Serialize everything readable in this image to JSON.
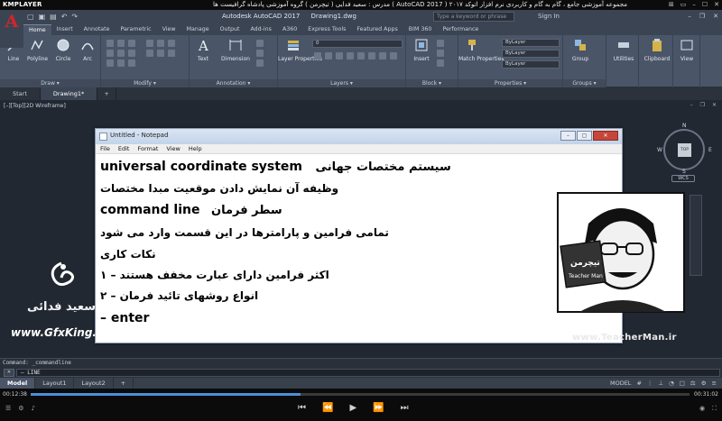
{
  "kmplayer": {
    "logo": "KMPLAYER",
    "title": "مجموعه آموزشی جامع ، گام به گام و کاربردی نرم افزار اتوکد ۲۰۱۷ ( AutoCAD 2017 ) مدرس : سعید فدایی ( تیچرمن ) گروه آموزشی پادشاه گرافیست ها",
    "ctrl_labels": [
      "⊞",
      "▭",
      "–",
      "☐",
      "✕"
    ]
  },
  "autocad": {
    "app_title": "Autodesk AutoCAD 2017",
    "doc_name": "Drawing1.dwg",
    "search_placeholder": "Type a keyword or phrase",
    "signin": "Sign In",
    "ribbon_tabs": [
      "Home",
      "Insert",
      "Annotate",
      "Parametric",
      "View",
      "Manage",
      "Output",
      "Add-ins",
      "A360",
      "Express Tools",
      "Featured Apps",
      "BIM 360",
      "Performance"
    ],
    "tools": {
      "line": "Line",
      "polyline": "Polyline",
      "circle": "Circle",
      "arc": "Arc",
      "text": "Text",
      "dimension": "Dimension",
      "layer_properties": "Layer Properties",
      "insert": "Insert",
      "match_properties": "Match Properties",
      "group": "Group",
      "utilities": "Utilities",
      "clipboard": "Clipboard",
      "view": "View"
    },
    "panels": {
      "draw": "Draw ▾",
      "modify": "Modify ▾",
      "annotation": "Annotation ▾",
      "layers": "Layers ▾",
      "block": "Block ▾",
      "properties": "Properties ▾",
      "groups": "Groups ▾"
    },
    "bylayer": [
      "ByLayer",
      "ByLayer",
      "ByLayer"
    ],
    "layer_dropdown": "0",
    "doc_tabs": [
      "Start",
      "Drawing1*"
    ],
    "viewport_label": "[–][Top][2D Wireframe]",
    "viewcube": {
      "top": "TOP",
      "n": "N",
      "s": "S",
      "w": "W",
      "e": "E",
      "wcs": "WCS"
    },
    "cmd_history": "Command: _commandline",
    "cmd_input": "– LINE",
    "layout_tabs": [
      "Model",
      "Layout1",
      "Layout2"
    ],
    "status_model": "MODEL"
  },
  "notepad": {
    "title": "Untitled - Notepad",
    "menu": [
      "File",
      "Edit",
      "Format",
      "View",
      "Help"
    ],
    "lines": [
      {
        "en": "universal coordinate system",
        "fa": "سیستم مختصات جهانی"
      },
      {
        "fa": "وظیفه آن نمایش دادن موقعیت مبدا مختصات"
      },
      {
        "en": "command line",
        "fa": "سطر فرمان"
      },
      {
        "fa": "تمامی فرامین و پارامترها در این قسمت وارد می شود"
      },
      {
        "fa": "نکات کاری"
      },
      {
        "fa": "اکثر فرامین دارای عبارت مخفف هستند  – ۱"
      },
      {
        "fa": "انواع روشهای تائید فرمان – ۲"
      },
      {
        "en": "– enter"
      }
    ]
  },
  "overlay": {
    "teacher_caption": "www.TeacherMan.ir",
    "badge_text": "تیچرمن",
    "badge_sub": "Teacher Man",
    "watermark_name": "سعید فدائی",
    "watermark_site": "www.GfxKing.ir"
  },
  "player": {
    "time_elapsed": "00:12:38",
    "time_total": "00:31:02",
    "progress": 0.41,
    "buttons": [
      "⏮",
      "⏪",
      "▶",
      "⏩",
      "⏭"
    ]
  }
}
